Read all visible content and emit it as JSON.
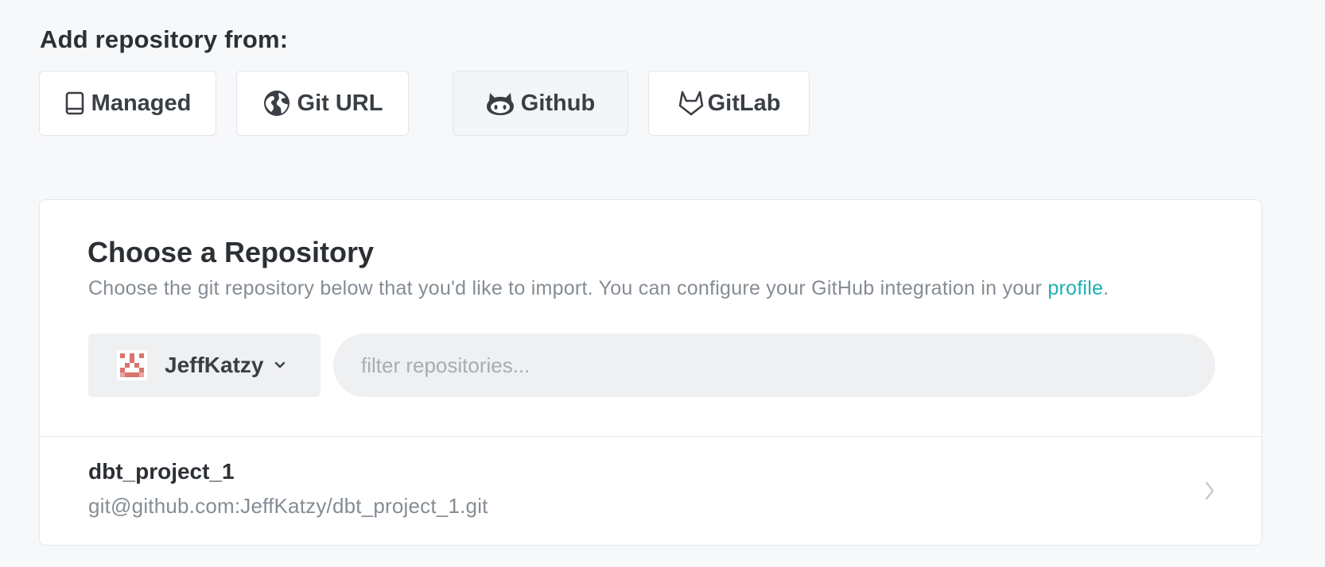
{
  "header": {
    "title": "Add repository from:"
  },
  "sources": [
    {
      "label": "Managed",
      "icon": "book-icon"
    },
    {
      "label": "Git URL",
      "icon": "globe-icon"
    },
    {
      "label": "Github",
      "icon": "github-icon",
      "selected": true
    },
    {
      "label": "GitLab",
      "icon": "gitlab-icon"
    }
  ],
  "card": {
    "title": "Choose a Repository",
    "description": "Choose the git repository below that you'd like to import. You can configure your GitHub integration in your ",
    "link_text": "profile",
    "description_end": "."
  },
  "org_selector": {
    "name": "JeffKatzy",
    "avatar_icon": "identicon-avatar",
    "chevron_icon": "chevron-down-icon"
  },
  "filter": {
    "value": "",
    "placeholder": "filter repositories..."
  },
  "repositories": [
    {
      "name": "dbt_project_1",
      "url": "git@github.com:JeffKatzy/dbt_project_1.git"
    }
  ],
  "colors": {
    "background": "#f7f8fa",
    "accent_link": "#1fb0b3",
    "avatar": "#d9746e",
    "muted_text": "#858c94"
  }
}
